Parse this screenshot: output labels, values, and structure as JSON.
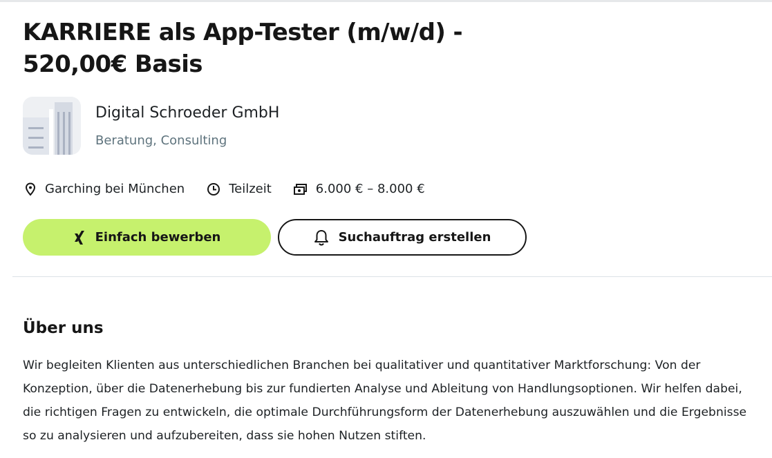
{
  "job": {
    "title": "KARRIERE als App-Tester (m/w/d) - 520,00€ Basis"
  },
  "company": {
    "name": "Digital Schroeder GmbH",
    "industry": "Beratung, Consulting",
    "logo_icon": "company-logo-placeholder"
  },
  "meta": {
    "location": "Garching bei München",
    "location_icon": "location-pin-icon",
    "employment_type": "Teilzeit",
    "employment_icon": "clock-icon",
    "salary": "6.000 € – 8.000 €",
    "salary_icon": "money-icon"
  },
  "actions": {
    "apply_label": "Einfach bewerben",
    "apply_icon": "xing-icon",
    "search_label": "Suchauftrag erstellen",
    "search_icon": "bell-icon"
  },
  "about": {
    "heading": "Über uns",
    "body": "Wir begleiten Klienten aus unterschiedlichen Branchen bei qualitativer und quantitativer Marktforschung: Von der Konzeption, über die Datenerhebung bis zur fundierten Analyse und Ableitung von Handlungsoptionen. Wir helfen dabei, die richtigen Fragen zu entwickeln, die optimale Durchführungsform der Datenerhebung auszuwählen und die Ergebnisse so zu analysieren und aufzubereiten, dass sie hohen Nutzen stiften."
  },
  "colors": {
    "accent": "#c6f16d",
    "text": "#161616",
    "muted": "#5e737d"
  }
}
